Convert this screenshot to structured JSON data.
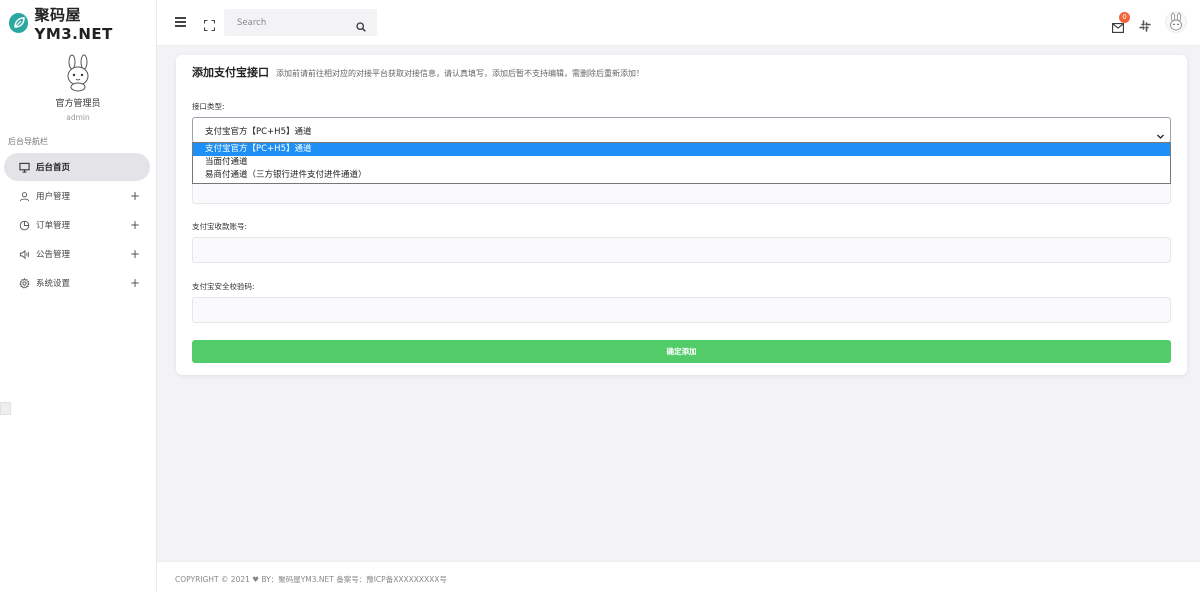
{
  "brand": {
    "name": "聚码屋YM3.NET",
    "logo_icon": "leaf-logo-icon"
  },
  "user": {
    "name": "官方管理员",
    "role": "admin"
  },
  "sidebar": {
    "section_title": "后台导航栏",
    "items": [
      {
        "label": "后台首页",
        "icon": "monitor-icon",
        "active": true,
        "expandable": false
      },
      {
        "label": "用户管理",
        "icon": "user-icon",
        "active": false,
        "expandable": true
      },
      {
        "label": "订单管理",
        "icon": "pie-chart-icon",
        "active": false,
        "expandable": true
      },
      {
        "label": "公告管理",
        "icon": "speaker-icon",
        "active": false,
        "expandable": true
      },
      {
        "label": "系统设置",
        "icon": "gear-icon",
        "active": false,
        "expandable": true
      }
    ],
    "plus": "+"
  },
  "topbar": {
    "search_placeholder": "Search",
    "mail_badge": "0"
  },
  "card": {
    "title": "添加支付宝接口",
    "description": "添加前请前往相对应的对接平台获取对接信息，请认真填写，添加后暂不支持编辑，需删除后重新添加！",
    "type_label": "接口类型:",
    "type_selected": "支付宝官方【PC+H5】通道",
    "type_options": [
      "支付宝官方【PC+H5】通道",
      "当面付通道",
      "易商付通道（三方银行进件支付进件通道）"
    ],
    "account_label": "支付宝收款账号:",
    "key_label": "支付宝安全校验码:",
    "submit_label": "确定添加"
  },
  "footer": {
    "text": "COPYRIGHT © 2021  ♥ BY：聚码屋YM3.NET    备案号：豫ICP备XXXXXXXXX号"
  },
  "colors": {
    "accent_blue": "#1e8ff5",
    "submit_green": "#52cc69",
    "badge_orange": "#f4623a"
  }
}
